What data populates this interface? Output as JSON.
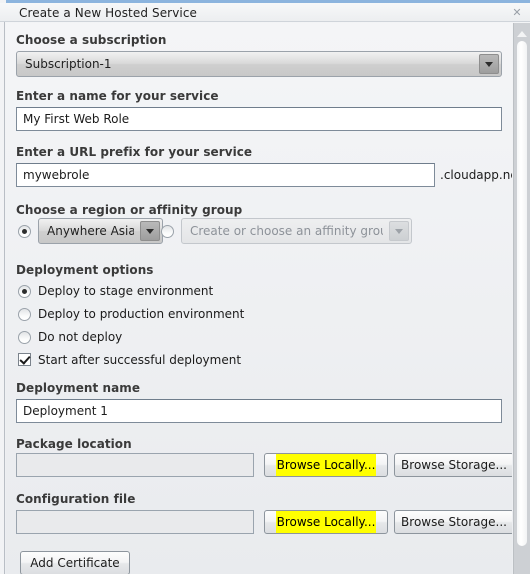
{
  "window": {
    "title": "Create a New Hosted Service",
    "close_icon": "close-icon",
    "close_glyph": "✕"
  },
  "form": {
    "subscription": {
      "label": "Choose a subscription",
      "value": "Subscription-1"
    },
    "service_name": {
      "label": "Enter a name for your service",
      "value": "My First Web Role",
      "placeholder": ""
    },
    "url_prefix": {
      "label": "Enter a URL prefix for your service",
      "value": "mywebrole",
      "placeholder": "",
      "suffix": ".cloudapp.net"
    },
    "region": {
      "label": "Choose a region or affinity group",
      "region_radio_checked": true,
      "region_value": "Anywhere Asia",
      "affinity_radio_checked": false,
      "affinity_value": "Create or choose an affinity group"
    },
    "deployment_options": {
      "label": "Deployment options",
      "options": [
        {
          "label": "Deploy to stage environment",
          "checked": true
        },
        {
          "label": "Deploy to production environment",
          "checked": false
        },
        {
          "label": "Do not deploy",
          "checked": false
        }
      ],
      "start_after": {
        "label": "Start after successful deployment",
        "checked": true
      }
    },
    "deployment_name": {
      "label": "Deployment name",
      "value": "Deployment 1",
      "placeholder": ""
    },
    "package_location": {
      "label": "Package location",
      "value": "",
      "placeholder": "",
      "browse_local_label": "Browse Locally...",
      "browse_storage_label": "Browse Storage..."
    },
    "configuration_file": {
      "label": "Configuration file",
      "value": "",
      "placeholder": "",
      "browse_local_label": "Browse Locally...",
      "browse_storage_label": "Browse Storage..."
    },
    "add_certificate_label": "Add Certificate"
  },
  "scrollbar": {
    "up_arrow_icon": "scroll-up-arrow-icon"
  },
  "colors": {
    "highlight": "#ffff00",
    "title_accent": "#8cb4de",
    "panel_bg": "#eef0f3"
  }
}
